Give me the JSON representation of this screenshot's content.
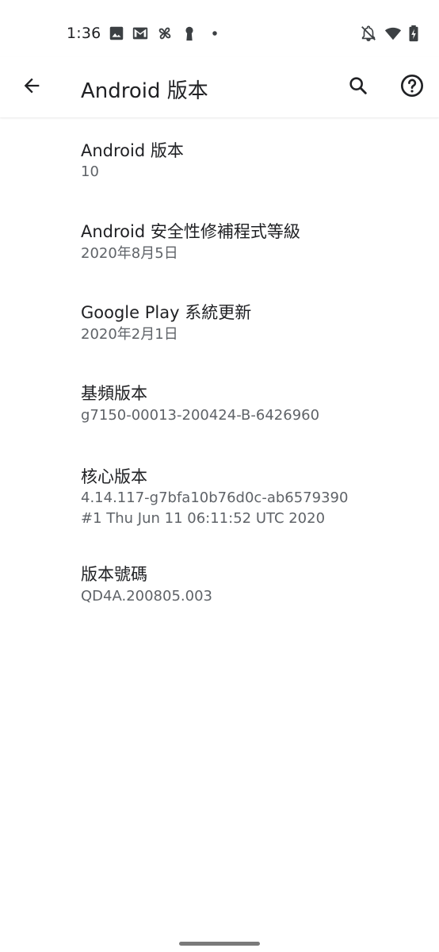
{
  "status_bar": {
    "time": "1:36",
    "left_icons": [
      "image-icon",
      "gmail-icon",
      "pinwheel-icon",
      "keyhole-icon",
      "dot-icon"
    ],
    "right_icons": [
      "bell-off-icon",
      "wifi-icon",
      "battery-charging-icon"
    ]
  },
  "app_bar": {
    "title": "Android 版本"
  },
  "items": [
    {
      "title": "Android 版本",
      "value": "10"
    },
    {
      "title": "Android 安全性修補程式等級",
      "value": "2020年8月5日"
    },
    {
      "title": "Google Play 系統更新",
      "value": "2020年2月1日"
    },
    {
      "title": "基頻版本",
      "value": "g7150-00013-200424-B-6426960"
    },
    {
      "title": "核心版本",
      "value_line1": "4.14.117-g7bfa10b76d0c-ab6579390",
      "value_line2": "#1 Thu Jun 11 06:11:52 UTC 2020"
    },
    {
      "title": "版本號碼",
      "value": "QD4A.200805.003"
    }
  ],
  "colors": {
    "primary_text": "#202124",
    "secondary_text": "#5f6368",
    "background": "#ffffff"
  }
}
